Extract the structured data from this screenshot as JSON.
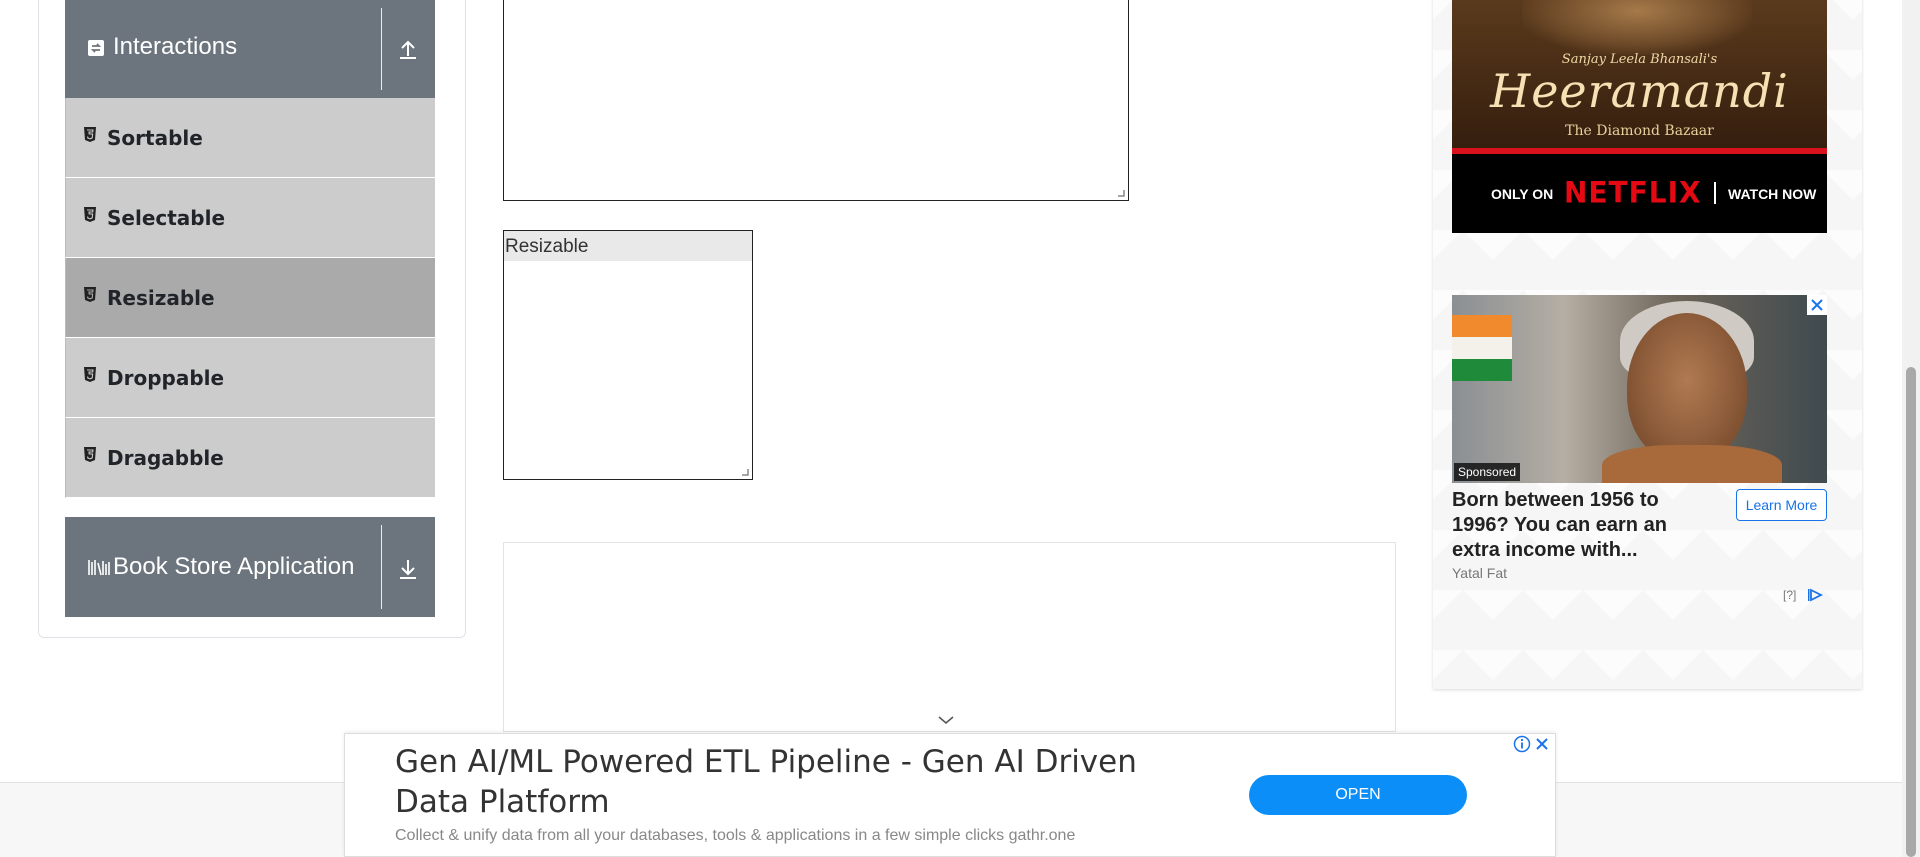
{
  "sidebar": {
    "groups": {
      "interactions": {
        "title": "Interactions",
        "icon": "interactions-icon",
        "toggle_icon": "collapse-up-icon"
      },
      "book_store": {
        "title": "Book Store Application",
        "icon": "books-icon",
        "toggle_icon": "expand-down-icon"
      }
    },
    "items": [
      {
        "label": "Sortable",
        "icon": "html5-icon",
        "active": false
      },
      {
        "label": "Selectable",
        "icon": "html5-icon",
        "active": false
      },
      {
        "label": "Resizable",
        "icon": "html5-icon",
        "active": true
      },
      {
        "label": "Droppable",
        "icon": "html5-icon",
        "active": false
      },
      {
        "label": "Dragabble",
        "icon": "html5-icon",
        "active": false
      }
    ]
  },
  "main": {
    "resizable_box": {
      "title": "Resizable"
    }
  },
  "ads": {
    "netflix": {
      "presenter": "Sanjay Leela Bhansali's",
      "title": "Heeramandi",
      "subtitle": "The Diamond Bazaar",
      "only_on": "ONLY ON",
      "brand": "NETFLIX",
      "cta": "WATCH NOW"
    },
    "sponsored": {
      "badge": "Sponsored",
      "headline": "Born between 1956 to 1996? You can earn an extra income with...",
      "cta": "Learn More",
      "advertiser": "Yatal Fat",
      "info": "[?]"
    },
    "bottom": {
      "headline": "Gen AI/ML Powered ETL Pipeline - Gen AI Driven Data Platform",
      "description": "Collect & unify data from all your databases, tools & applications in a few simple clicks gathr.one",
      "cta": "OPEN"
    }
  },
  "colors": {
    "group_header_bg": "#6c757d",
    "menu_item_bg": "#cccccc",
    "menu_item_active_bg": "#aaaaaa",
    "cta_blue": "#0c8ef8",
    "netflix_red": "#e50914"
  }
}
